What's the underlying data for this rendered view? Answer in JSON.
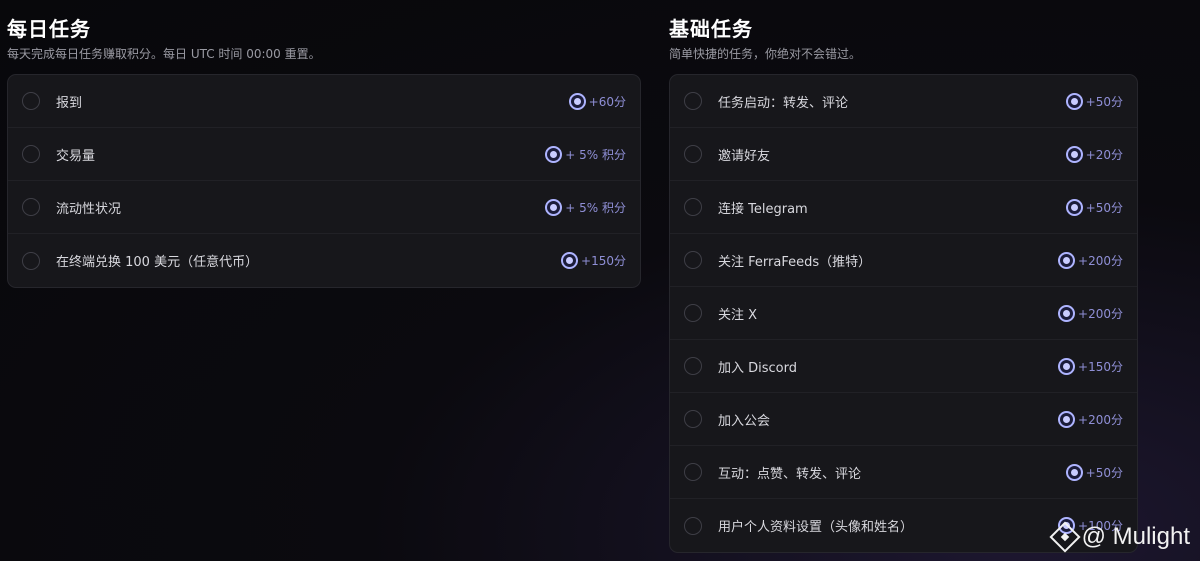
{
  "daily": {
    "title": "每日任务",
    "subtitle": "每天完成每日任务赚取积分。每日 UTC 时间 00:00 重置。",
    "tasks": [
      {
        "label": "报到",
        "points": "+60分"
      },
      {
        "label": "交易量",
        "points": "+ 5% 积分"
      },
      {
        "label": "流动性状况",
        "points": "+ 5% 积分"
      },
      {
        "label": "在终端兑换 100 美元（任意代币）",
        "points": "+150分"
      }
    ]
  },
  "basic": {
    "title": "基础任务",
    "subtitle": "简单快捷的任务，你绝对不会错过。",
    "tasks": [
      {
        "label": "任务启动：转发、评论",
        "points": "+50分"
      },
      {
        "label": "邀请好友",
        "points": "+20分"
      },
      {
        "label": "连接 Telegram",
        "points": "+50分"
      },
      {
        "label": "关注 FerraFeeds（推特）",
        "points": "+200分"
      },
      {
        "label": "关注 X",
        "points": "+200分"
      },
      {
        "label": "加入 Discord",
        "points": "+150分"
      },
      {
        "label": "加入公会",
        "points": "+200分"
      },
      {
        "label": "互动：点赞、转发、评论",
        "points": "+50分"
      },
      {
        "label": "用户个人资料设置（头像和姓名）",
        "points": "+100分"
      }
    ]
  },
  "watermark": {
    "text": "@ Mulight"
  },
  "icons": {
    "checkbox": "empty-circle-checkbox-icon",
    "reward": "points-coin-icon",
    "logo": "binance-square-logo-icon"
  },
  "colors": {
    "background": "#0b0a0f",
    "card": "#17171b",
    "accent_points": "#8f8fd6",
    "coin_ring": "#aeb4ff"
  }
}
